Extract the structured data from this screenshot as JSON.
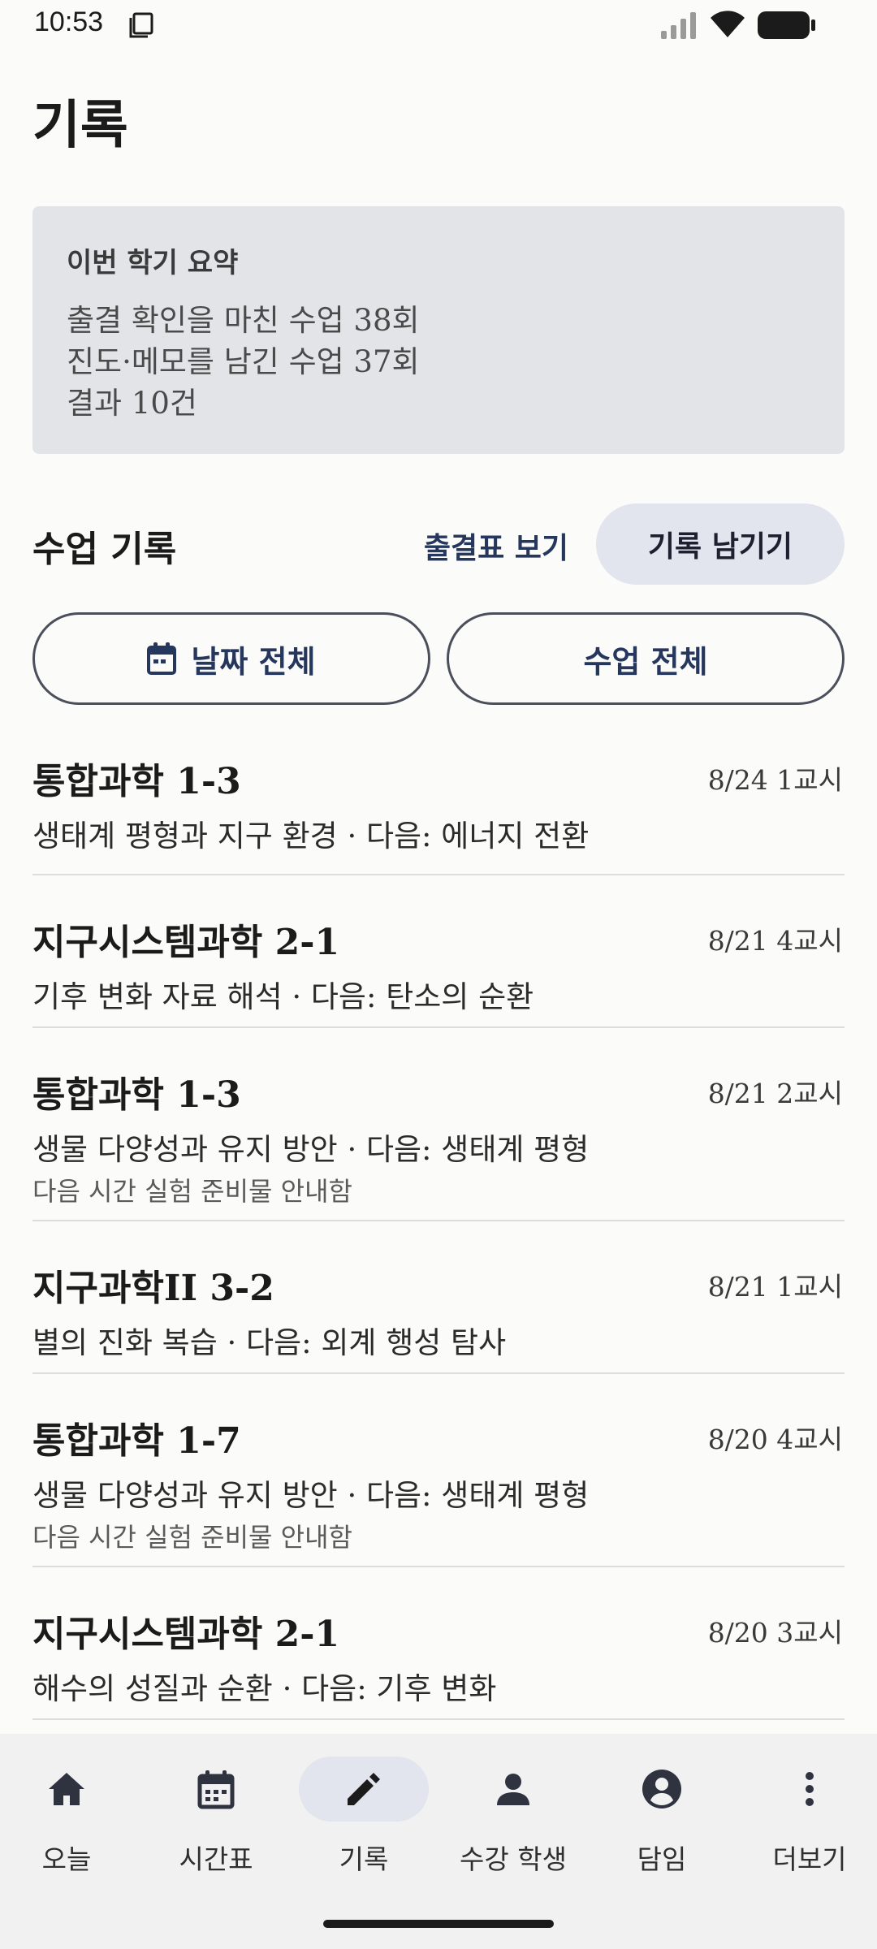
{
  "status": {
    "time": "10:53"
  },
  "page": {
    "title": "기록"
  },
  "summary": {
    "title": "이번 학기 요약",
    "lines": [
      "출결 확인을 마친 수업 38회",
      "진도·메모를 남긴 수업 37회",
      "결과 10건"
    ]
  },
  "section": {
    "title": "수업 기록",
    "attendance_link": "출결표 보기",
    "record_button": "기록 남기기"
  },
  "filters": {
    "date": "날짜 전체",
    "class": "수업 전체"
  },
  "records": [
    {
      "title": "통합과학 1-3",
      "date": "8/24 1교시",
      "desc": "생태계 평형과 지구 환경 · 다음: 에너지 전환",
      "note": ""
    },
    {
      "title": "지구시스템과학 2-1",
      "date": "8/21 4교시",
      "desc": "기후 변화 자료 해석 · 다음: 탄소의 순환",
      "note": ""
    },
    {
      "title": "통합과학 1-3",
      "date": "8/21 2교시",
      "desc": "생물 다양성과 유지 방안 · 다음: 생태계 평형",
      "note": "다음 시간 실험 준비물 안내함"
    },
    {
      "title": "지구과학II 3-2",
      "date": "8/21 1교시",
      "desc": "별의 진화 복습 · 다음: 외계 행성 탐사",
      "note": ""
    },
    {
      "title": "통합과학 1-7",
      "date": "8/20 4교시",
      "desc": "생물 다양성과 유지 방안 · 다음: 생태계 평형",
      "note": "다음 시간 실험 준비물 안내함"
    },
    {
      "title": "지구시스템과학 2-1",
      "date": "8/20 3교시",
      "desc": "해수의 성질과 순환 · 다음: 기후 변화",
      "note": ""
    }
  ],
  "nav": [
    {
      "label": "오늘",
      "icon": "home-icon",
      "active": false
    },
    {
      "label": "시간표",
      "icon": "calendar-icon",
      "active": false
    },
    {
      "label": "기록",
      "icon": "pencil-icon",
      "active": true
    },
    {
      "label": "수강 학생",
      "icon": "person-icon",
      "active": false
    },
    {
      "label": "담임",
      "icon": "account-circle-icon",
      "active": false
    },
    {
      "label": "더보기",
      "icon": "more-vert-icon",
      "active": false
    }
  ],
  "colors": {
    "accent": "#26375e",
    "pill": "#e2e4ee",
    "summary_bg": "#e3e4e7"
  }
}
